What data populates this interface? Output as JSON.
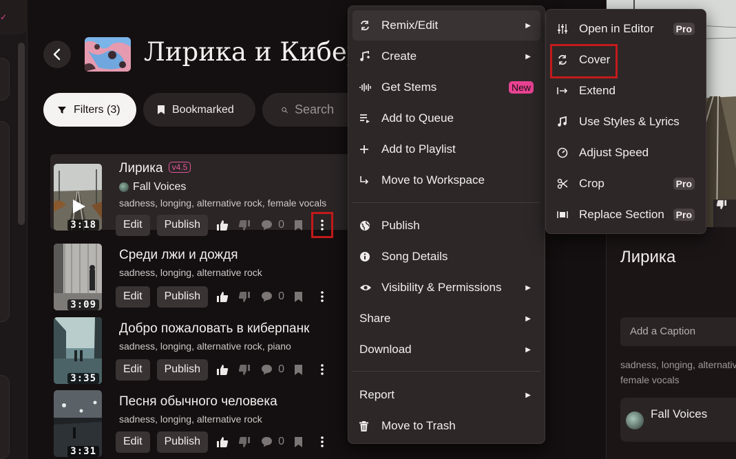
{
  "page": {
    "title": "Лирика и Киберпанк",
    "filters_label": "Filters (3)",
    "bookmarked_label": "Bookmarked",
    "search_placeholder": "Search"
  },
  "songs": [
    {
      "title": "Лирика",
      "version": "v4.5",
      "artist": "Fall Voices",
      "tags": "sadness, longing, alternative rock, female vocals",
      "duration": "3:18",
      "edit": "Edit",
      "publish": "Publish",
      "comments": "0"
    },
    {
      "title": "Среди лжи и дождя",
      "tags": "sadness, longing, alternative rock",
      "duration": "3:09",
      "edit": "Edit",
      "publish": "Publish",
      "comments": "0"
    },
    {
      "title": "Добро пожаловать в киберпанк",
      "tags": "sadness, longing, alternative rock, piano",
      "duration": "3:35",
      "edit": "Edit",
      "publish": "Publish",
      "comments": "0"
    },
    {
      "title": "Песня обычного человека",
      "tags": "sadness, longing, alternative rock",
      "duration": "3:31",
      "edit": "Edit",
      "publish": "Publish",
      "comments": "0"
    }
  ],
  "context_menu": {
    "remix_edit": "Remix/Edit",
    "create": "Create",
    "get_stems": "Get Stems",
    "new_badge": "New",
    "add_to_queue": "Add to Queue",
    "add_to_playlist": "Add to Playlist",
    "move_to_workspace": "Move to Workspace",
    "publish": "Publish",
    "song_details": "Song Details",
    "visibility": "Visibility & Permissions",
    "share": "Share",
    "download": "Download",
    "report": "Report",
    "move_to_trash": "Move to Trash"
  },
  "submenu": {
    "open_in_editor": "Open in Editor",
    "cover": "Cover",
    "extend": "Extend",
    "use_styles_lyrics": "Use Styles & Lyrics",
    "adjust_speed": "Adjust Speed",
    "crop": "Crop",
    "replace_section": "Replace Section",
    "pro_badge": "Pro"
  },
  "right_panel": {
    "title": "Лирика",
    "caption_placeholder": "Add a Caption",
    "tags_line1": "sadness, longing, alternative rock,",
    "tags_line2": "female vocals",
    "artist": "Fall Voices"
  },
  "colors": {
    "accent_pink": "#e84393",
    "highlight_red": "#c41a1a",
    "background": "#140f10"
  }
}
